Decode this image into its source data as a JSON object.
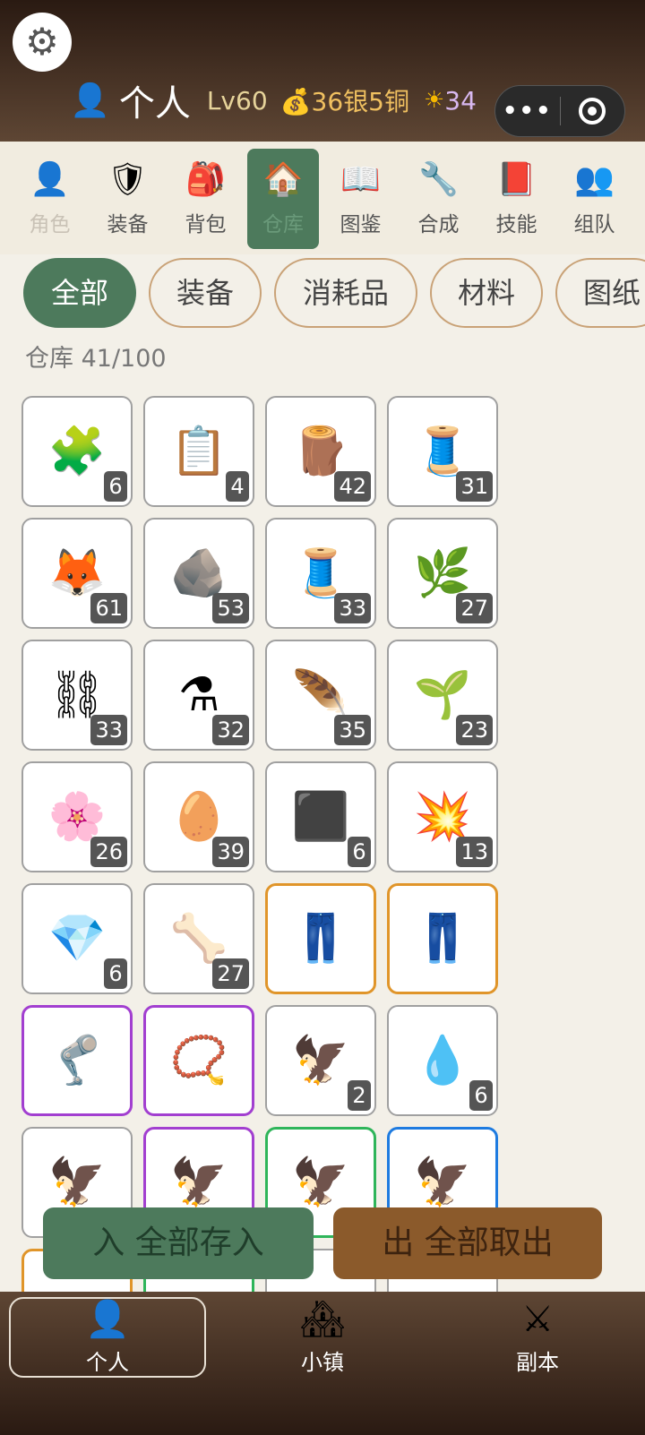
{
  "header": {
    "user_name": "个人",
    "level": "Lv60",
    "money": "💰36银5铜",
    "energy_icon": "☀",
    "energy": "34",
    "capsule_menu": "•••"
  },
  "nav": [
    {
      "label": "角色",
      "icon": "👤"
    },
    {
      "label": "装备",
      "icon": "🛡"
    },
    {
      "label": "背包",
      "icon": "🎒"
    },
    {
      "label": "仓库",
      "icon": "🏠"
    },
    {
      "label": "图鉴",
      "icon": "📖"
    },
    {
      "label": "合成",
      "icon": "🔧"
    },
    {
      "label": "技能",
      "icon": "📕"
    },
    {
      "label": "组队",
      "icon": "👥"
    }
  ],
  "tabs": [
    "全部",
    "装备",
    "消耗品",
    "材料",
    "图纸"
  ],
  "warehouse": {
    "label": "仓库 41/100"
  },
  "items": [
    {
      "icon": "🧩",
      "qty": "6"
    },
    {
      "icon": "📋",
      "qty": "4"
    },
    {
      "icon": "🪵",
      "qty": "42"
    },
    {
      "icon": "🧵",
      "qty": "31"
    },
    {
      "icon": "🦊",
      "qty": "61"
    },
    {
      "icon": "🪨",
      "qty": "53"
    },
    {
      "icon": "🧵",
      "qty": "33"
    },
    {
      "icon": "🌿",
      "qty": "27"
    },
    {
      "icon": "⛓",
      "qty": "33"
    },
    {
      "icon": "⚗",
      "qty": "32"
    },
    {
      "icon": "🪶",
      "qty": "35"
    },
    {
      "icon": "🌱",
      "qty": "23"
    },
    {
      "icon": "🌸",
      "qty": "26"
    },
    {
      "icon": "🥚",
      "qty": "39"
    },
    {
      "icon": "⬛",
      "qty": "6"
    },
    {
      "icon": "💥",
      "qty": "13"
    },
    {
      "icon": "💎",
      "qty": "6"
    },
    {
      "icon": "🦴",
      "qty": "27"
    },
    {
      "icon": "👖",
      "qty": "",
      "rarity": "orange"
    },
    {
      "icon": "👖",
      "qty": "",
      "rarity": "orange"
    },
    {
      "icon": "🦿",
      "qty": "",
      "rarity": "purple"
    },
    {
      "icon": "📿",
      "qty": "",
      "rarity": "purple"
    },
    {
      "icon": "🦅",
      "qty": "2"
    },
    {
      "icon": "💧",
      "qty": "6"
    },
    {
      "icon": "🦅",
      "qty": ""
    },
    {
      "icon": "🦅",
      "qty": "",
      "rarity": "purple"
    },
    {
      "icon": "🦅",
      "qty": "",
      "rarity": "green"
    },
    {
      "icon": "🦅",
      "qty": "",
      "rarity": "blue"
    },
    {
      "icon": "",
      "qty": "",
      "rarity": "orange"
    },
    {
      "icon": "",
      "qty": "",
      "rarity": "green"
    },
    {
      "icon": "",
      "qty": ""
    },
    {
      "icon": "",
      "qty": ""
    }
  ],
  "actions": {
    "store_all": "入 全部存入",
    "take_all": "出 全部取出"
  },
  "bottom_nav": [
    {
      "label": "个人",
      "icon": "👤"
    },
    {
      "label": "小镇",
      "icon": "🏘"
    },
    {
      "label": "副本",
      "icon": "⚔"
    }
  ]
}
